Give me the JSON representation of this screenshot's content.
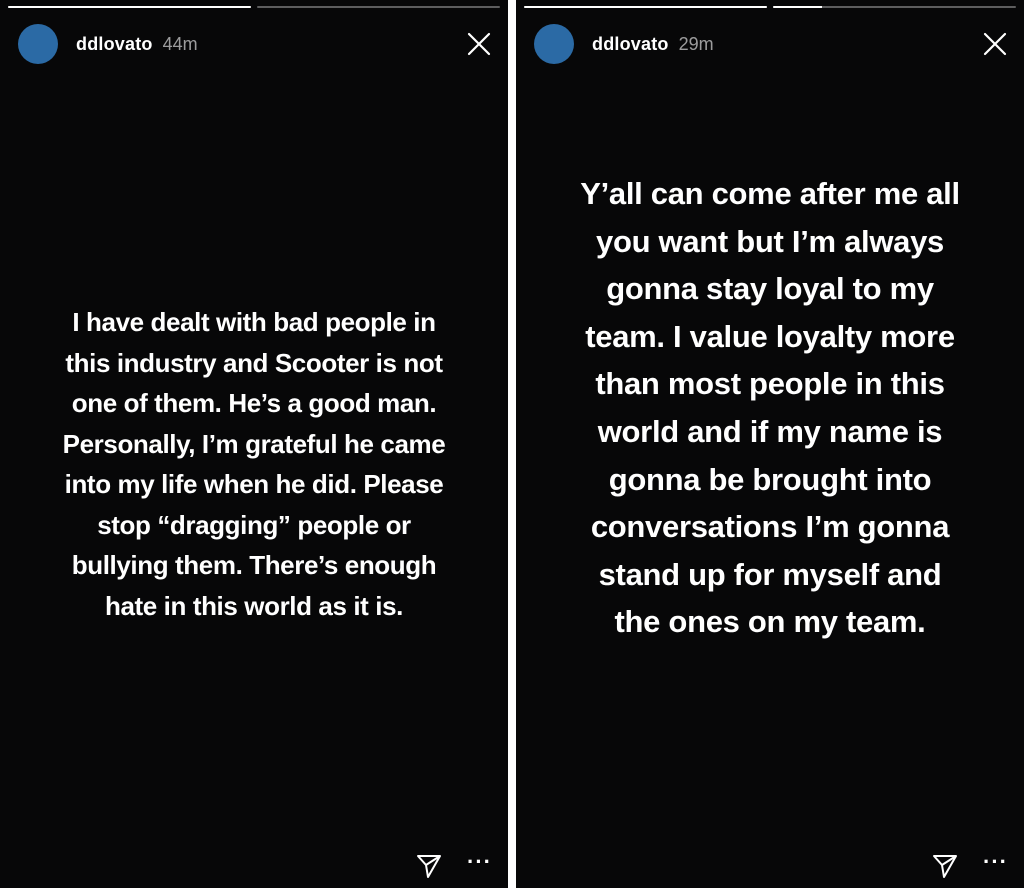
{
  "colors": {
    "story_background": "#070708",
    "text": "#ffffff",
    "avatar": "#2b6aa5",
    "divider": "#ffffff"
  },
  "stories": [
    {
      "username": "ddlovato",
      "timestamp": "44m",
      "progress": [
        1.0,
        0.0
      ],
      "caption": "I have dealt with bad people in\nthis industry and Scooter is not\none of them. He’s a good man.\nPersonally, I’m grateful he came\ninto my life when he did.  Please\nstop “dragging” people or\nbullying them. There’s enough\nhate in this world as it is.",
      "icons": {
        "close": "close-icon",
        "send": "send-icon",
        "more": "more-icon"
      },
      "more_label": "···"
    },
    {
      "username": "ddlovato",
      "timestamp": "29m",
      "progress": [
        1.0,
        0.2
      ],
      "caption": "Y’all can come after me all\nyou want but I’m always\ngonna stay loyal to my\nteam. I value loyalty more\nthan most people in this\nworld and if my name is\ngonna be brought into\nconversations I’m gonna\nstand up for myself and\nthe ones on my team.",
      "icons": {
        "close": "close-icon",
        "send": "send-icon",
        "more": "more-icon"
      },
      "more_label": "···"
    }
  ]
}
